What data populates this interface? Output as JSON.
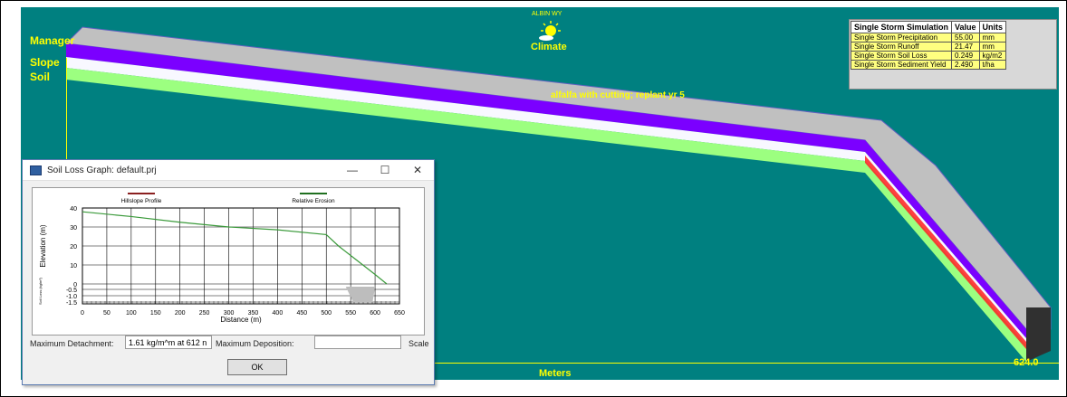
{
  "canvas": {
    "labels": {
      "management": "Manager",
      "slope": "Slope",
      "soil": "Soil"
    },
    "climate": {
      "station": "ALBIN WY",
      "label": "Climate",
      "icon": "sun-cloud-icon"
    },
    "crop_label": "alfalfa with cutting; replant yr 5",
    "axis_label": "Meters",
    "length_value": "624.0",
    "colors": {
      "background": "#008080",
      "management": "#c0c0c0",
      "slope": "#7b00ff",
      "soil": "#9cff80",
      "highlight": "#ffff00"
    }
  },
  "simulation": {
    "headers": [
      "Single Storm Simulation",
      "Value",
      "Units"
    ],
    "rows": [
      [
        "Single Storm Precipitation",
        "55.00",
        "mm"
      ],
      [
        "Single Storm Runoff",
        "21.47",
        "mm"
      ],
      [
        "Single Storm Soil Loss",
        "0.249",
        "kg/m2"
      ],
      [
        "Single Storm Sediment Yield",
        "2.490",
        "t/ha"
      ]
    ]
  },
  "dialog": {
    "title": "Soil Loss Graph: default.prj",
    "minimize": "—",
    "maximize": "☐",
    "close": "✕",
    "max_detachment_label": "Maximum Detachment:",
    "max_detachment_value": "1.61 kg/m^m at 612 n",
    "max_deposition_label": "Maximum Deposition:",
    "max_deposition_value": "",
    "scale_label": "Scale",
    "ok_label": "OK"
  },
  "chart_data": {
    "type": "line",
    "legend": [
      "Hillslope Profile",
      "Relative Erosion"
    ],
    "legend_colors": [
      "#8b2020",
      "#207020"
    ],
    "ylabel": "Elevation (m)",
    "ylabel_small": "Soil Loss (kg/m²)",
    "xlabel": "Distance (m)",
    "x_ticks": [
      "0",
      "50",
      "100",
      "150",
      "200",
      "250",
      "300",
      "350",
      "400",
      "450",
      "500",
      "550",
      "600",
      "650"
    ],
    "y_ticks": [
      "40",
      "30",
      "20",
      "10",
      "0"
    ],
    "y_ticks_loss": [
      "-0.5",
      "-1.0",
      "-1.5"
    ],
    "xlim": [
      0,
      650
    ],
    "ylim": [
      0,
      40
    ],
    "series": [
      {
        "name": "Hillslope Profile",
        "x": [
          0,
          100,
          200,
          300,
          400,
          500,
          525,
          550,
          575,
          600,
          624
        ],
        "y": [
          38,
          35.5,
          32.5,
          30,
          28.5,
          26,
          20,
          15,
          10,
          5,
          0
        ]
      }
    ]
  }
}
